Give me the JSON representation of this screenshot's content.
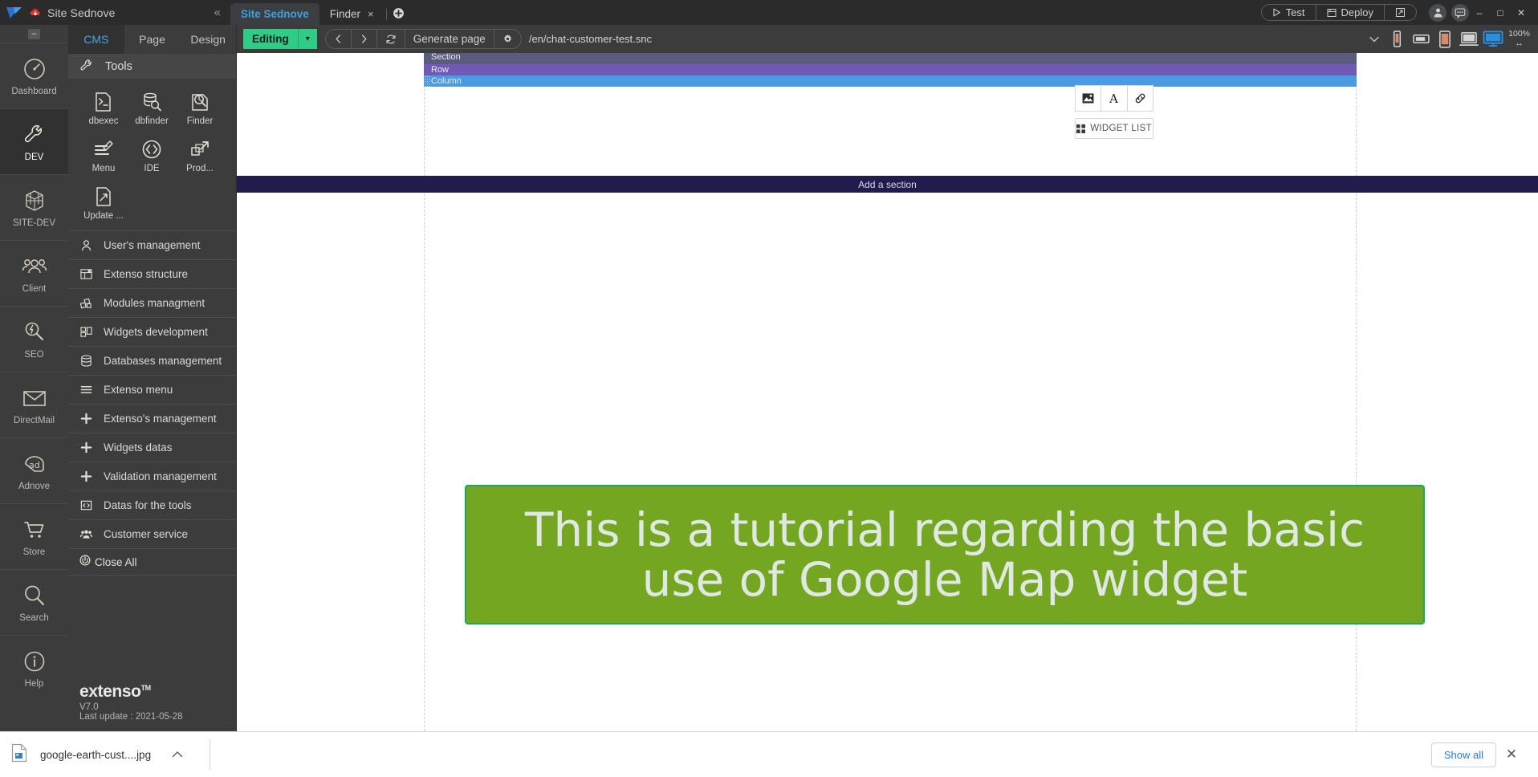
{
  "titlebar": {
    "app_title": "Site Sednove",
    "collapse_icon": "chevrons-left-icon",
    "tabs": [
      {
        "label": "Site Sednove",
        "active": true,
        "closable": false
      },
      {
        "label": "Finder",
        "active": false,
        "closable": true,
        "close_glyph": "×"
      }
    ],
    "new_tab_icon": "plus-circle-icon",
    "actions": [
      {
        "label": "Test",
        "icon": "play-icon"
      },
      {
        "label": "Deploy",
        "icon": "deploy-icon"
      },
      {
        "label": "",
        "icon": "external-link-icon"
      }
    ],
    "account_icon": "user-avatar-icon",
    "chat_icon": "chat-bubble-icon",
    "window_buttons": [
      "minimize-icon",
      "maximize-icon",
      "close-icon"
    ]
  },
  "rail": {
    "collapse_glyph": "–",
    "items": [
      {
        "label": "Dashboard",
        "icon": "gauge-icon",
        "active": false
      },
      {
        "label": "DEV",
        "icon": "wrench-icon",
        "active": true
      },
      {
        "label": "SITE-DEV",
        "icon": "cube-icon",
        "active": false
      },
      {
        "label": "Client",
        "icon": "users-icon",
        "active": false
      },
      {
        "label": "SEO",
        "icon": "seo-magnifier-icon",
        "active": false
      },
      {
        "label": "DirectMail",
        "icon": "envelope-icon",
        "active": false
      },
      {
        "label": "Adnove",
        "icon": "ad-badge-icon",
        "active": false
      },
      {
        "label": "Store",
        "icon": "shopping-cart-icon",
        "active": false
      },
      {
        "label": "Search",
        "icon": "magnifier-icon",
        "active": false
      },
      {
        "label": "Help",
        "icon": "info-circle-icon",
        "active": false
      }
    ]
  },
  "panel": {
    "nav": [
      {
        "label": "CMS",
        "active": true
      },
      {
        "label": "Page",
        "active": false
      },
      {
        "label": "Design",
        "active": false
      }
    ],
    "tools_header": {
      "title": "Tools",
      "icon": "wrench-icon"
    },
    "tools": [
      {
        "label": "dbexec",
        "icon": "terminal-file-icon"
      },
      {
        "label": "dbfinder",
        "icon": "database-search-icon"
      },
      {
        "label": "Finder",
        "icon": "chart-search-icon"
      },
      {
        "label": "Menu",
        "icon": "menu-edit-icon"
      },
      {
        "label": "IDE",
        "icon": "code-circle-icon"
      },
      {
        "label": "Prod...",
        "icon": "deploy-arrow-icon"
      },
      {
        "label": "Update ...",
        "icon": "file-edit-icon"
      }
    ],
    "menu_items": [
      {
        "label": "User's management",
        "icon": "person-icon"
      },
      {
        "label": "Extenso structure",
        "icon": "structure-icon"
      },
      {
        "label": "Modules managment",
        "icon": "modules-icon"
      },
      {
        "label": "Widgets development",
        "icon": "widgets-icon"
      },
      {
        "label": "Databases management",
        "icon": "database-icon"
      },
      {
        "label": "Extenso menu",
        "icon": "hamburger-icon"
      },
      {
        "label": "Extenso's management",
        "icon": "plus-icon"
      },
      {
        "label": "Widgets datas",
        "icon": "plus-icon"
      },
      {
        "label": "Validation management",
        "icon": "plus-icon"
      },
      {
        "label": "Datas for the tools",
        "icon": "code-brackets-icon"
      },
      {
        "label": "Customer service",
        "icon": "people-group-icon"
      }
    ],
    "close_all": {
      "label": "Close All",
      "icon": "power-icon"
    },
    "brand": {
      "name": "extenso",
      "trademark": "TM",
      "version": "V7.0",
      "last_update": "Last update : 2021-05-28"
    }
  },
  "editor_toolbar": {
    "status": {
      "label": "Editing",
      "caret": "▾"
    },
    "nav_back_icon": "chevron-left-icon",
    "nav_forward_icon": "chevron-right-icon",
    "refresh_icon": "refresh-icon",
    "generate_page_label": "Generate page",
    "settings_icon": "gear-icon",
    "url_value": "/en/chat-customer-test.snc",
    "url_caret_icon": "chevron-down-icon",
    "devices": [
      {
        "icon": "phone-portrait-icon",
        "active": false
      },
      {
        "icon": "phone-landscape-icon",
        "active": false
      },
      {
        "icon": "tablet-icon",
        "active": false
      },
      {
        "icon": "laptop-icon",
        "active": false
      },
      {
        "icon": "desktop-icon",
        "active": true
      }
    ],
    "zoom_label": "100%",
    "zoom_sub_icon": "arrows-horizontal-icon"
  },
  "canvas": {
    "section_label": "Section",
    "row_label": "Row",
    "column_label": "Column",
    "widget_buttons": [
      {
        "icon": "image-icon"
      },
      {
        "icon": "text-a-icon"
      },
      {
        "icon": "link-chain-icon"
      }
    ],
    "widget_list_label": "WIDGET LIST",
    "widget_list_icon": "grid-icon",
    "add_section_label": "Add a section",
    "banner_text": "This is a tutorial regarding the basic use of Google Map widget",
    "banner_bg": "#74a621",
    "banner_border": "#19ab5a",
    "banner_text_color": "#dfe9e2"
  },
  "download_bar": {
    "file_name": "google-earth-cust....jpg",
    "file_icon": "image-file-icon",
    "caret_icon": "chevron-up-icon",
    "show_all_label": "Show all",
    "close_icon": "close-icon"
  }
}
